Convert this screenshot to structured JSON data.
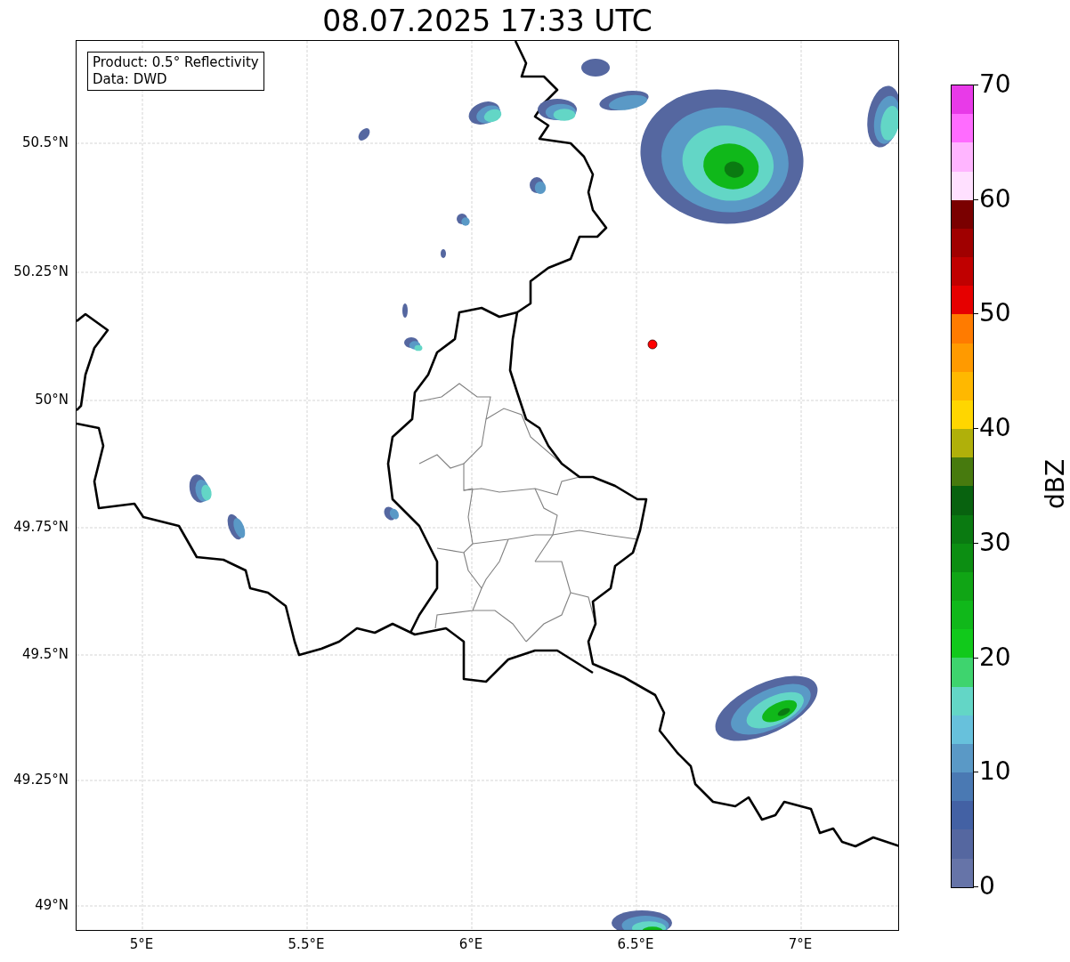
{
  "title": "08.07.2025 17:33 UTC",
  "info_box": [
    "Product: 0.5° Reflectivity",
    "Data: DWD"
  ],
  "map": {
    "lat_labels": [
      "50.5°N",
      "50.25°N",
      "50°N",
      "49.75°N",
      "49.5°N",
      "49.25°N",
      "49°N"
    ],
    "lon_labels": [
      "5°E",
      "5.5°E",
      "6°E",
      "6.5°E",
      "7°E"
    ]
  },
  "colorbar": {
    "label": "dBZ",
    "ticks": [
      "70",
      "60",
      "50",
      "40",
      "30",
      "20",
      "10",
      "0"
    ],
    "bands": [
      {
        "color": "#e83ae8"
      },
      {
        "color": "#ff6cff"
      },
      {
        "color": "#ffb5ff"
      },
      {
        "color": "#ffe0ff"
      },
      {
        "color": "#7a0000"
      },
      {
        "color": "#a00000"
      },
      {
        "color": "#c00000"
      },
      {
        "color": "#e60000"
      },
      {
        "color": "#ff7b00"
      },
      {
        "color": "#ff9a00"
      },
      {
        "color": "#ffb800"
      },
      {
        "color": "#ffd600"
      },
      {
        "color": "#b0b00a"
      },
      {
        "color": "#477a0e"
      },
      {
        "color": "#08620f"
      },
      {
        "color": "#0a7a11"
      },
      {
        "color": "#0c8e12"
      },
      {
        "color": "#10a515"
      },
      {
        "color": "#10b81a"
      },
      {
        "color": "#11c91b"
      },
      {
        "color": "#3ed46e"
      },
      {
        "color": "#63d6c6"
      },
      {
        "color": "#67c1dc"
      },
      {
        "color": "#5a99c6"
      },
      {
        "color": "#4a79b3"
      },
      {
        "color": "#4361a4"
      },
      {
        "color": "#5567a0"
      },
      {
        "color": "#6674a8"
      }
    ]
  }
}
